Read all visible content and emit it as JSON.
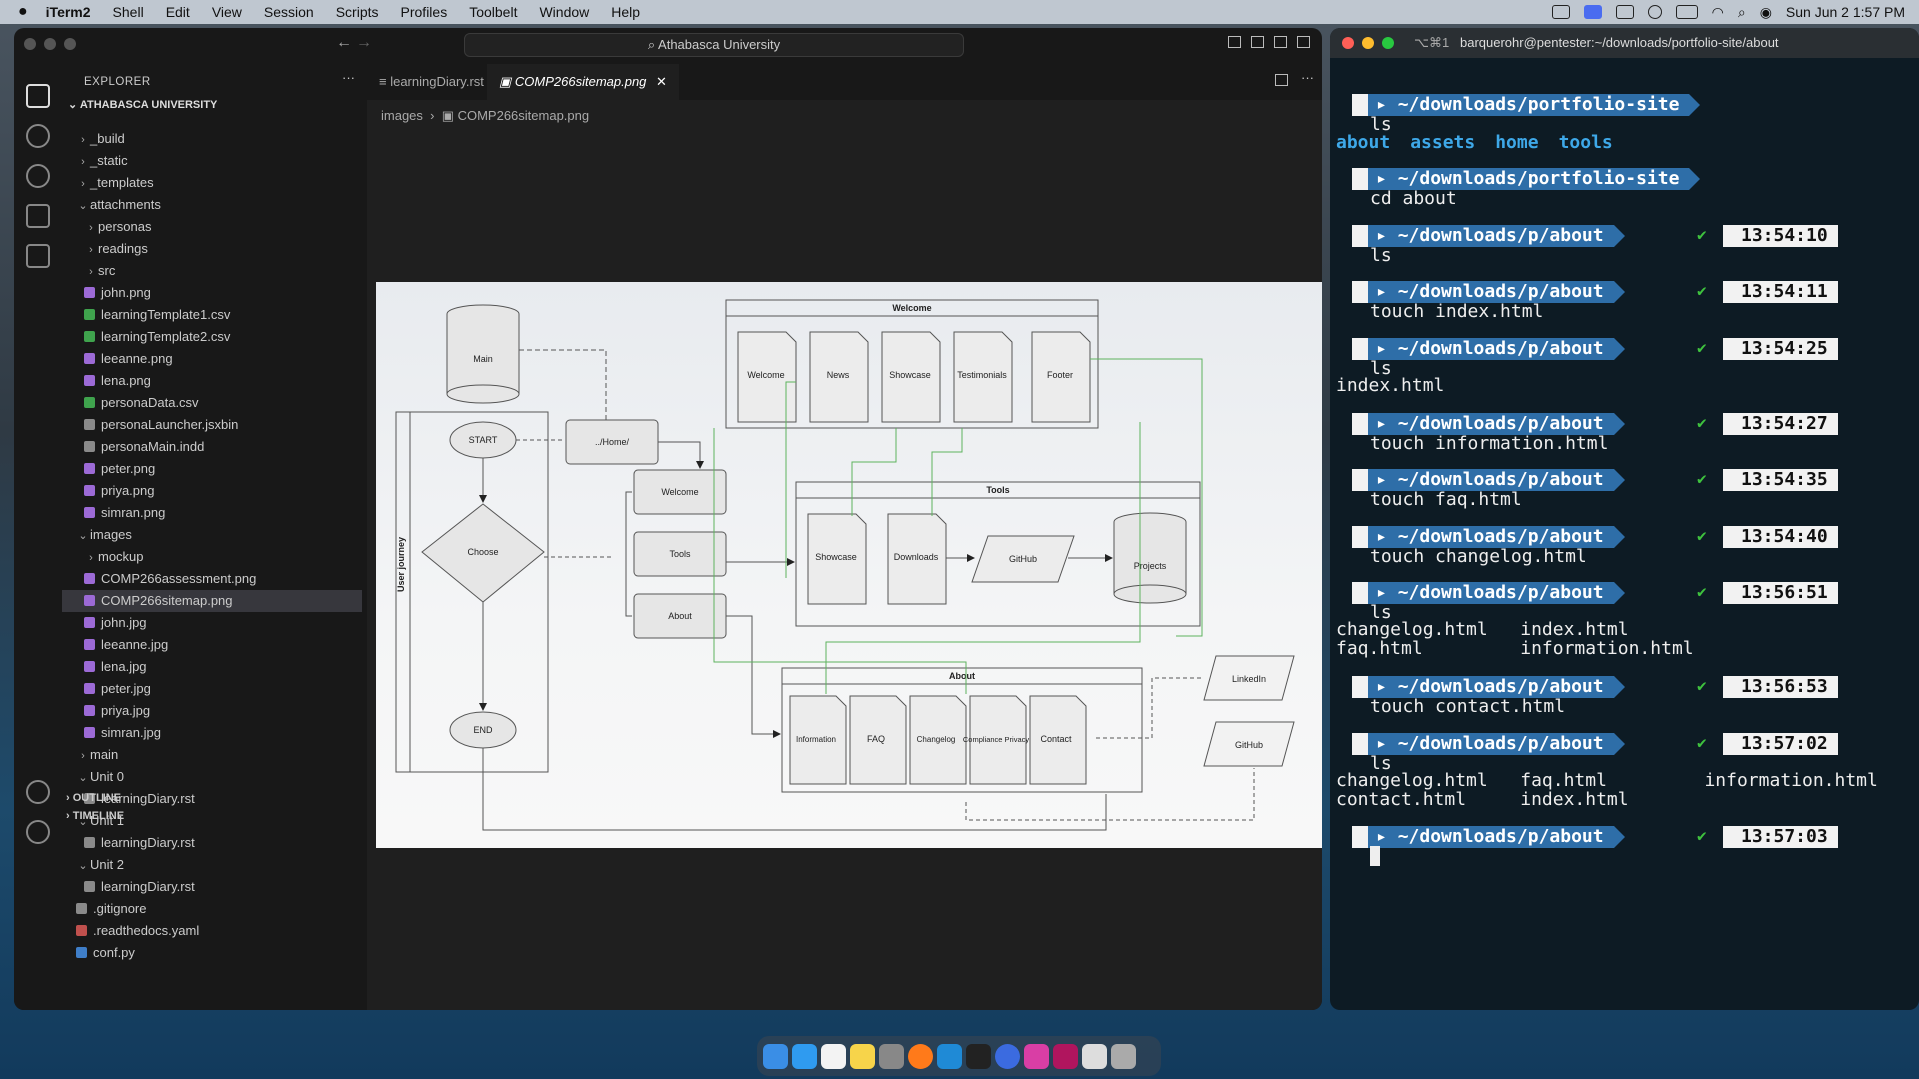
{
  "menubar": {
    "apple": "",
    "app": "iTerm2",
    "items": [
      "Shell",
      "Edit",
      "View",
      "Session",
      "Scripts",
      "Profiles",
      "Toolbelt",
      "Window",
      "Help"
    ],
    "datetime": "Sun Jun 2  1:57 PM"
  },
  "vscode": {
    "search": "Athabasca University",
    "explorer_title": "EXPLORER",
    "root": "ATHABASCA UNIVERSITY",
    "tree": [
      {
        "label": "_build",
        "indent": 1,
        "type": "folder",
        "open": false
      },
      {
        "label": "_static",
        "indent": 1,
        "type": "folder",
        "open": false
      },
      {
        "label": "_templates",
        "indent": 1,
        "type": "folder",
        "open": false
      },
      {
        "label": "attachments",
        "indent": 1,
        "type": "folder",
        "open": true
      },
      {
        "label": "personas",
        "indent": 2,
        "type": "folder",
        "open": false
      },
      {
        "label": "readings",
        "indent": 2,
        "type": "folder",
        "open": false
      },
      {
        "label": "src",
        "indent": 2,
        "type": "folder",
        "open": false
      },
      {
        "label": "john.png",
        "indent": 2,
        "type": "img"
      },
      {
        "label": "learningTemplate1.csv",
        "indent": 2,
        "type": "csv"
      },
      {
        "label": "learningTemplate2.csv",
        "indent": 2,
        "type": "csv"
      },
      {
        "label": "leeanne.png",
        "indent": 2,
        "type": "img"
      },
      {
        "label": "lena.png",
        "indent": 2,
        "type": "img"
      },
      {
        "label": "personaData.csv",
        "indent": 2,
        "type": "csv"
      },
      {
        "label": "personaLauncher.jsxbin",
        "indent": 2,
        "type": "txt"
      },
      {
        "label": "personaMain.indd",
        "indent": 2,
        "type": "txt"
      },
      {
        "label": "peter.png",
        "indent": 2,
        "type": "img"
      },
      {
        "label": "priya.png",
        "indent": 2,
        "type": "img"
      },
      {
        "label": "simran.png",
        "indent": 2,
        "type": "img"
      },
      {
        "label": "images",
        "indent": 1,
        "type": "folder",
        "open": true
      },
      {
        "label": "mockup",
        "indent": 2,
        "type": "folder",
        "open": false
      },
      {
        "label": "COMP266assessment.png",
        "indent": 2,
        "type": "img"
      },
      {
        "label": "COMP266sitemap.png",
        "indent": 2,
        "type": "img",
        "selected": true
      },
      {
        "label": "john.jpg",
        "indent": 2,
        "type": "img"
      },
      {
        "label": "leeanne.jpg",
        "indent": 2,
        "type": "img"
      },
      {
        "label": "lena.jpg",
        "indent": 2,
        "type": "img"
      },
      {
        "label": "peter.jpg",
        "indent": 2,
        "type": "img"
      },
      {
        "label": "priya.jpg",
        "indent": 2,
        "type": "img"
      },
      {
        "label": "simran.jpg",
        "indent": 2,
        "type": "img"
      },
      {
        "label": "main",
        "indent": 1,
        "type": "folder",
        "open": false
      },
      {
        "label": "Unit 0",
        "indent": 1,
        "type": "folder",
        "open": true
      },
      {
        "label": "learningDiary.rst",
        "indent": 2,
        "type": "txt"
      },
      {
        "label": "Unit 1",
        "indent": 1,
        "type": "folder",
        "open": true
      },
      {
        "label": "learningDiary.rst",
        "indent": 2,
        "type": "txt"
      },
      {
        "label": "Unit 2",
        "indent": 1,
        "type": "folder",
        "open": true
      },
      {
        "label": "learningDiary.rst",
        "indent": 2,
        "type": "txt"
      },
      {
        "label": ".gitignore",
        "indent": 1,
        "type": "txt"
      },
      {
        "label": ".readthedocs.yaml",
        "indent": 1,
        "type": "yaml"
      },
      {
        "label": "conf.py",
        "indent": 1,
        "type": "py"
      }
    ],
    "outline": "OUTLINE",
    "timeline": "TIMELINE",
    "tabs": [
      "learningDiary.rst",
      "COMP266sitemap.png"
    ],
    "breadcrumb": [
      "images",
      "COMP266sitemap.png"
    ]
  },
  "diagram": {
    "main": "Main",
    "home": "../Home/",
    "start": "START",
    "choose": "Choose",
    "end": "END",
    "journey": "User journey",
    "welcome_btn": "Welcome",
    "tools_btn": "Tools",
    "about_btn": "About",
    "welcome_group": "Welcome",
    "welcome_pages": [
      "Welcome",
      "News",
      "Showcase",
      "Testimonials",
      "Footer"
    ],
    "tools_group": "Tools",
    "tools_pages": [
      "Showcase",
      "Downloads"
    ],
    "github": "GitHub",
    "projects": "Projects",
    "about_group": "About",
    "about_pages": [
      "Information",
      "FAQ",
      "Changelog",
      "Compliance Privacy",
      "Contact"
    ],
    "linkedin": "LinkedIn",
    "github2": "GitHub"
  },
  "terminal": {
    "title": "barquerohr@pentester:~/downloads/portfolio-site/about",
    "shortcut": "⌥⌘1",
    "blocks": [
      {
        "path": "~/downloads/",
        "bold": "portfolio-site",
        "cmd": "ls",
        "time": "",
        "out": []
      },
      {
        "out": [
          "about",
          "assets",
          "home",
          "tools"
        ],
        "dir": true
      },
      {
        "path": "~/downloads/",
        "bold": "portfolio-site",
        "cmd": "cd about",
        "time": ""
      },
      {
        "path": "~/downloads/p/",
        "bold": "about",
        "cmd": "ls",
        "time": "13:54:10"
      },
      {
        "path": "~/downloads/p/",
        "bold": "about",
        "cmd": "touch index.html",
        "time": "13:54:11"
      },
      {
        "path": "~/downloads/p/",
        "bold": "about",
        "cmd": "ls",
        "time": "13:54:25"
      },
      {
        "path": "~/downloads/p/",
        "bold": "about",
        "cmd": "touch information.html",
        "time": "13:54:27"
      },
      {
        "path": "~/downloads/p/",
        "bold": "about",
        "cmd": "touch faq.html",
        "time": "13:54:35"
      },
      {
        "path": "~/downloads/p/",
        "bold": "about",
        "cmd": "touch changelog.html",
        "time": "13:54:40"
      },
      {
        "path": "~/downloads/p/",
        "bold": "about",
        "cmd": "ls",
        "time": "13:56:51"
      },
      {
        "path": "~/downloads/p/",
        "bold": "about",
        "cmd": "touch contact.html",
        "time": "13:56:53"
      },
      {
        "path": "~/downloads/p/",
        "bold": "about",
        "cmd": "ls",
        "time": "13:57:02"
      },
      {
        "path": "~/downloads/p/",
        "bold": "about",
        "cmd": "",
        "time": "13:57:03"
      }
    ],
    "outputs": {
      "ls1": [
        "about",
        "assets",
        "home",
        "tools"
      ],
      "ls2": "index.html",
      "ls3": [
        "changelog.html   index.html",
        "faq.html         information.html"
      ],
      "ls4": [
        "changelog.html   faq.html         information.html",
        "contact.html     index.html"
      ]
    }
  }
}
